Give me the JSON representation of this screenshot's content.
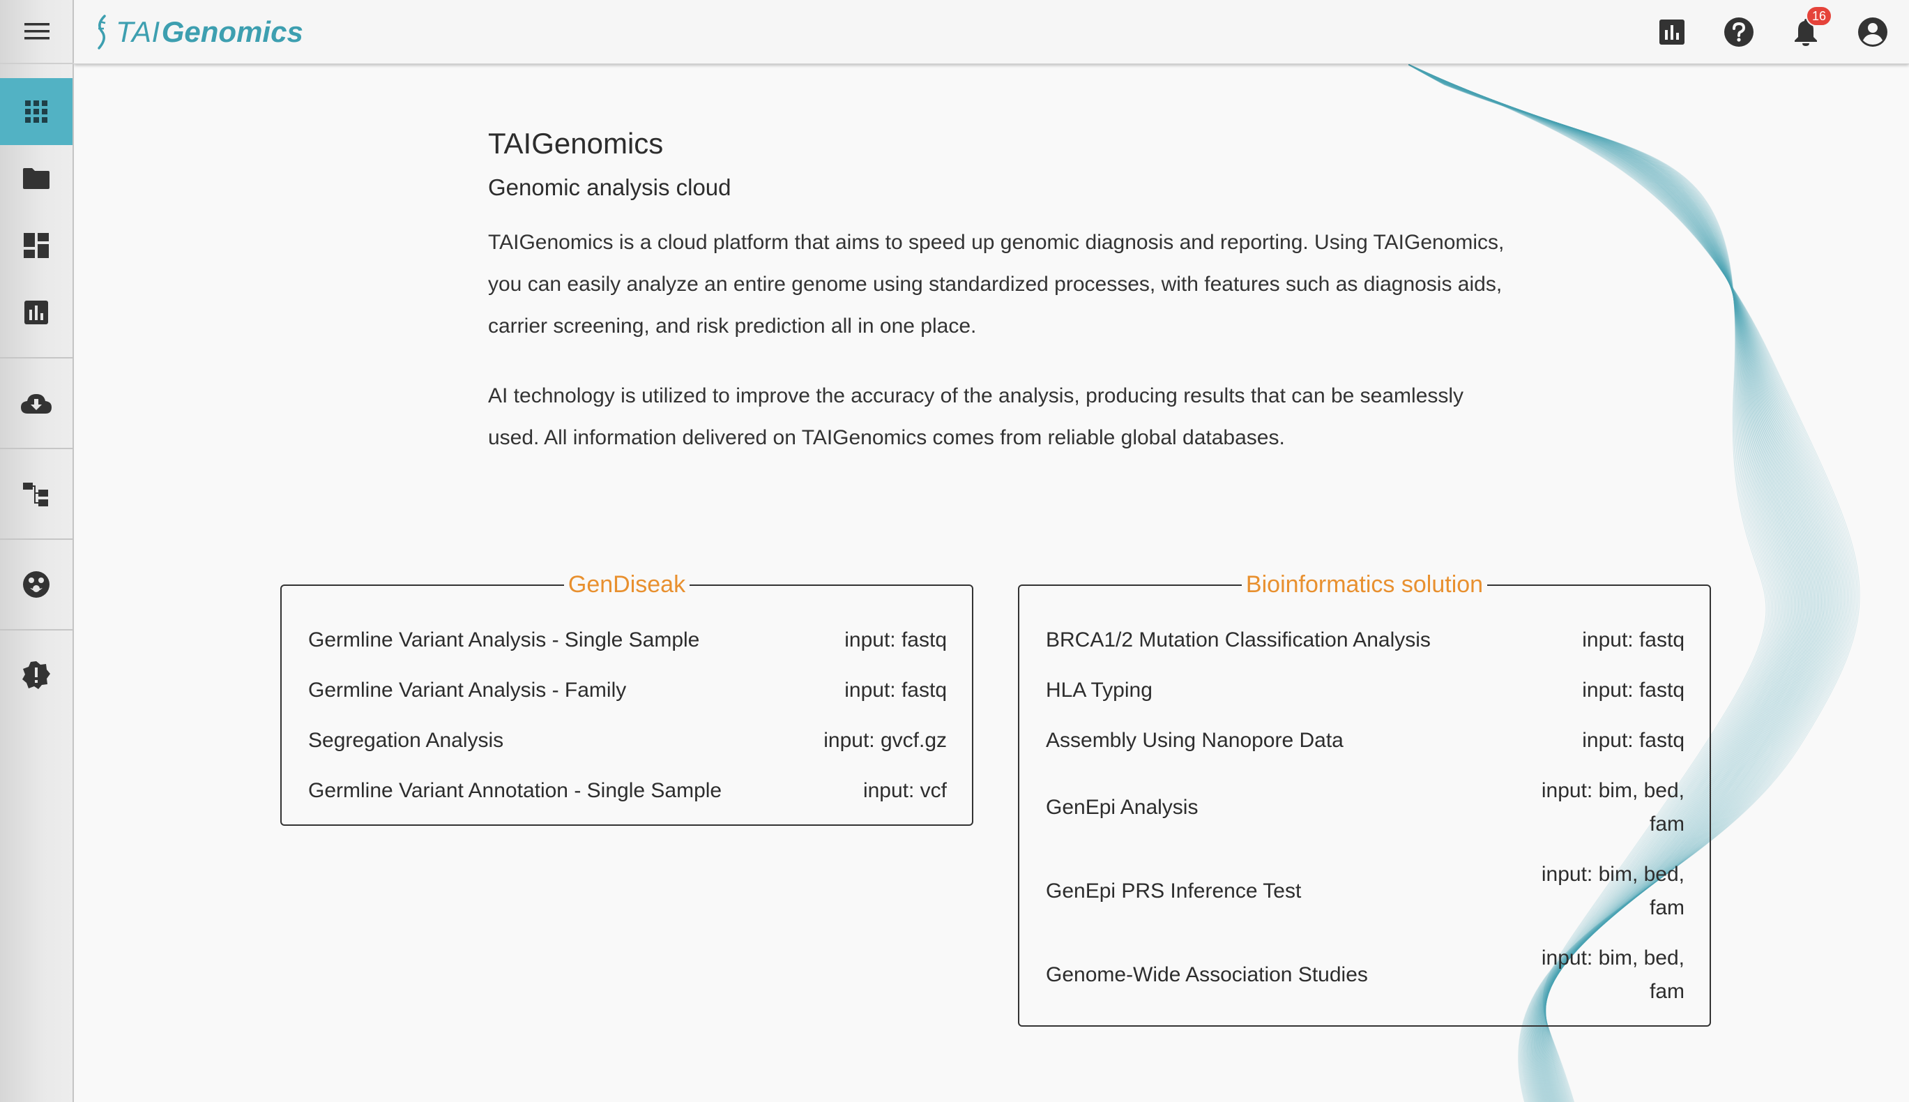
{
  "header": {
    "logo_prefix": "TAI",
    "logo_suffix": "Genomics",
    "notification_count": "16"
  },
  "sidebar": {
    "items": [
      {
        "icon": "apps-grid-icon"
      },
      {
        "icon": "folder-icon"
      },
      {
        "icon": "dashboard-icon"
      },
      {
        "icon": "bar-chart-icon"
      },
      {
        "icon": "cloud-download-icon"
      },
      {
        "icon": "hierarchy-icon"
      },
      {
        "icon": "face-icon"
      },
      {
        "icon": "alert-badge-icon"
      }
    ]
  },
  "intro": {
    "title": "TAIGenomics",
    "subtitle": "Genomic analysis cloud",
    "paragraph1": "TAIGenomics is a cloud platform that aims to speed up genomic diagnosis and reporting. Using TAIGenomics, you can easily analyze an entire genome using standardized processes, with features such as diagnosis aids, carrier screening, and risk prediction all in one place.",
    "paragraph2": "AI technology is utilized to improve the accuracy of the analysis, producing results that can be seamlessly used. All information delivered on TAIGenomics comes from reliable global databases."
  },
  "gendiseak": {
    "title": "GenDiseak",
    "items": [
      {
        "name": "Germline Variant Analysis - Single Sample",
        "input": "input: fastq"
      },
      {
        "name": "Germline Variant Analysis - Family",
        "input": "input: fastq"
      },
      {
        "name": "Segregation Analysis",
        "input": "input: gvcf.gz"
      },
      {
        "name": "Germline Variant Annotation - Single Sample",
        "input": "input: vcf"
      }
    ]
  },
  "bioinformatics": {
    "title": "Bioinformatics solution",
    "items": [
      {
        "name": "BRCA1/2 Mutation Classification Analysis",
        "input": "input: fastq"
      },
      {
        "name": "HLA Typing",
        "input": "input: fastq"
      },
      {
        "name": "Assembly Using Nanopore Data",
        "input": "input: fastq"
      },
      {
        "name": "GenEpi Analysis",
        "input_line1": "input: bim, bed,",
        "input_line2": "fam"
      },
      {
        "name": "GenEpi PRS Inference Test",
        "input_line1": "input: bim, bed,",
        "input_line2": "fam"
      },
      {
        "name": "Genome-Wide Association Studies",
        "input_line1": "input: bim, bed,",
        "input_line2": "fam"
      }
    ]
  },
  "colors": {
    "accent": "#52b2c4",
    "brand": "#3d9fb0",
    "legend": "#e8902f",
    "badge": "#e5433a"
  }
}
